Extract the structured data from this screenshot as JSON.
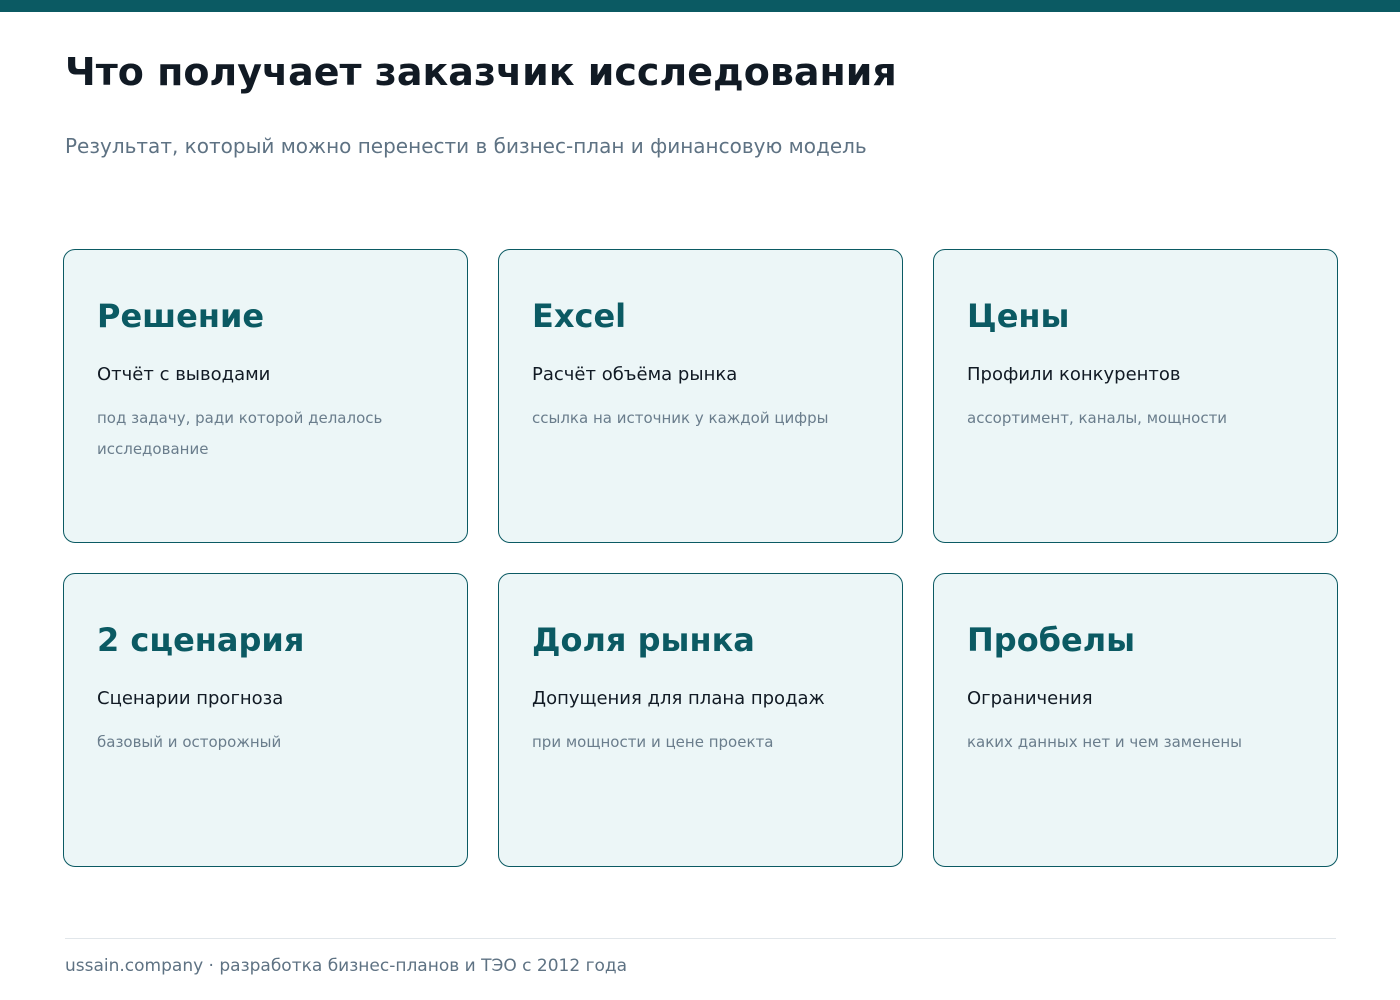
{
  "header": {
    "title": "Что получает заказчик исследования",
    "subtitle": "Результат, который можно перенести в бизнес-план и финансовую модель"
  },
  "colors": {
    "accent": "#0b5a63",
    "card_background": "#ecf6f7",
    "title_text": "#111a24",
    "muted_text": "#5e7283"
  },
  "cards": [
    {
      "value": "Решение",
      "label": "Отчёт с выводами",
      "description": "под задачу, ради которой делалось исследование"
    },
    {
      "value": "Excel",
      "label": "Расчёт объёма рынка",
      "description": "ссылка на источник у каждой цифры"
    },
    {
      "value": "Цены",
      "label": "Профили конкурентов",
      "description": "ассортимент, каналы, мощности"
    },
    {
      "value": "2 сценария",
      "label": "Сценарии прогноза",
      "description": "базовый и осторожный"
    },
    {
      "value": "Доля рынка",
      "label": "Допущения для плана продаж",
      "description": "при мощности и цене проекта"
    },
    {
      "value": "Пробелы",
      "label": "Ограничения",
      "description": "каких данных нет и чем заменены"
    }
  ],
  "footer": {
    "text": "ussain.company · разработка бизнес-планов и ТЭО с 2012 года"
  }
}
